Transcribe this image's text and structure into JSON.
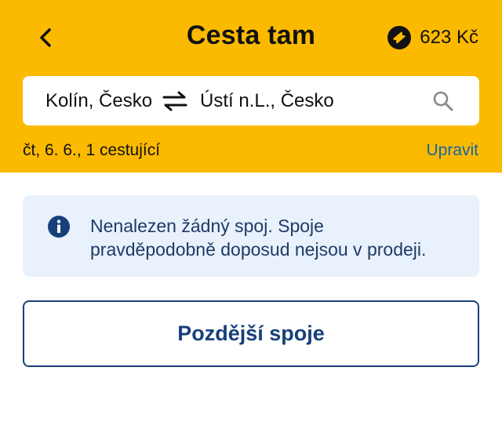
{
  "header": {
    "title": "Cesta tam",
    "back_icon": "chevron-left-icon",
    "credit": {
      "icon": "ticket-icon",
      "amount": "623 Kč"
    }
  },
  "route": {
    "from": "Kolín, Česko",
    "to": "Ústí n.L., Česko",
    "swap_icon": "swap-arrows-icon",
    "search_icon": "search-icon"
  },
  "trip": {
    "info": "čt, 6. 6., 1 cestující",
    "edit_label": "Upravit"
  },
  "notice": {
    "icon": "info-icon",
    "text_line1": "Nenalezen žádný spoj. Spoje",
    "text_line2": "pravděpodobně doposud nejsou v prodeji."
  },
  "actions": {
    "later_label": "Pozdější spoje"
  },
  "colors": {
    "header_bg": "#FBBA00",
    "notice_bg": "#E8F1FC",
    "primary": "#17407A",
    "link": "#1565A8"
  }
}
